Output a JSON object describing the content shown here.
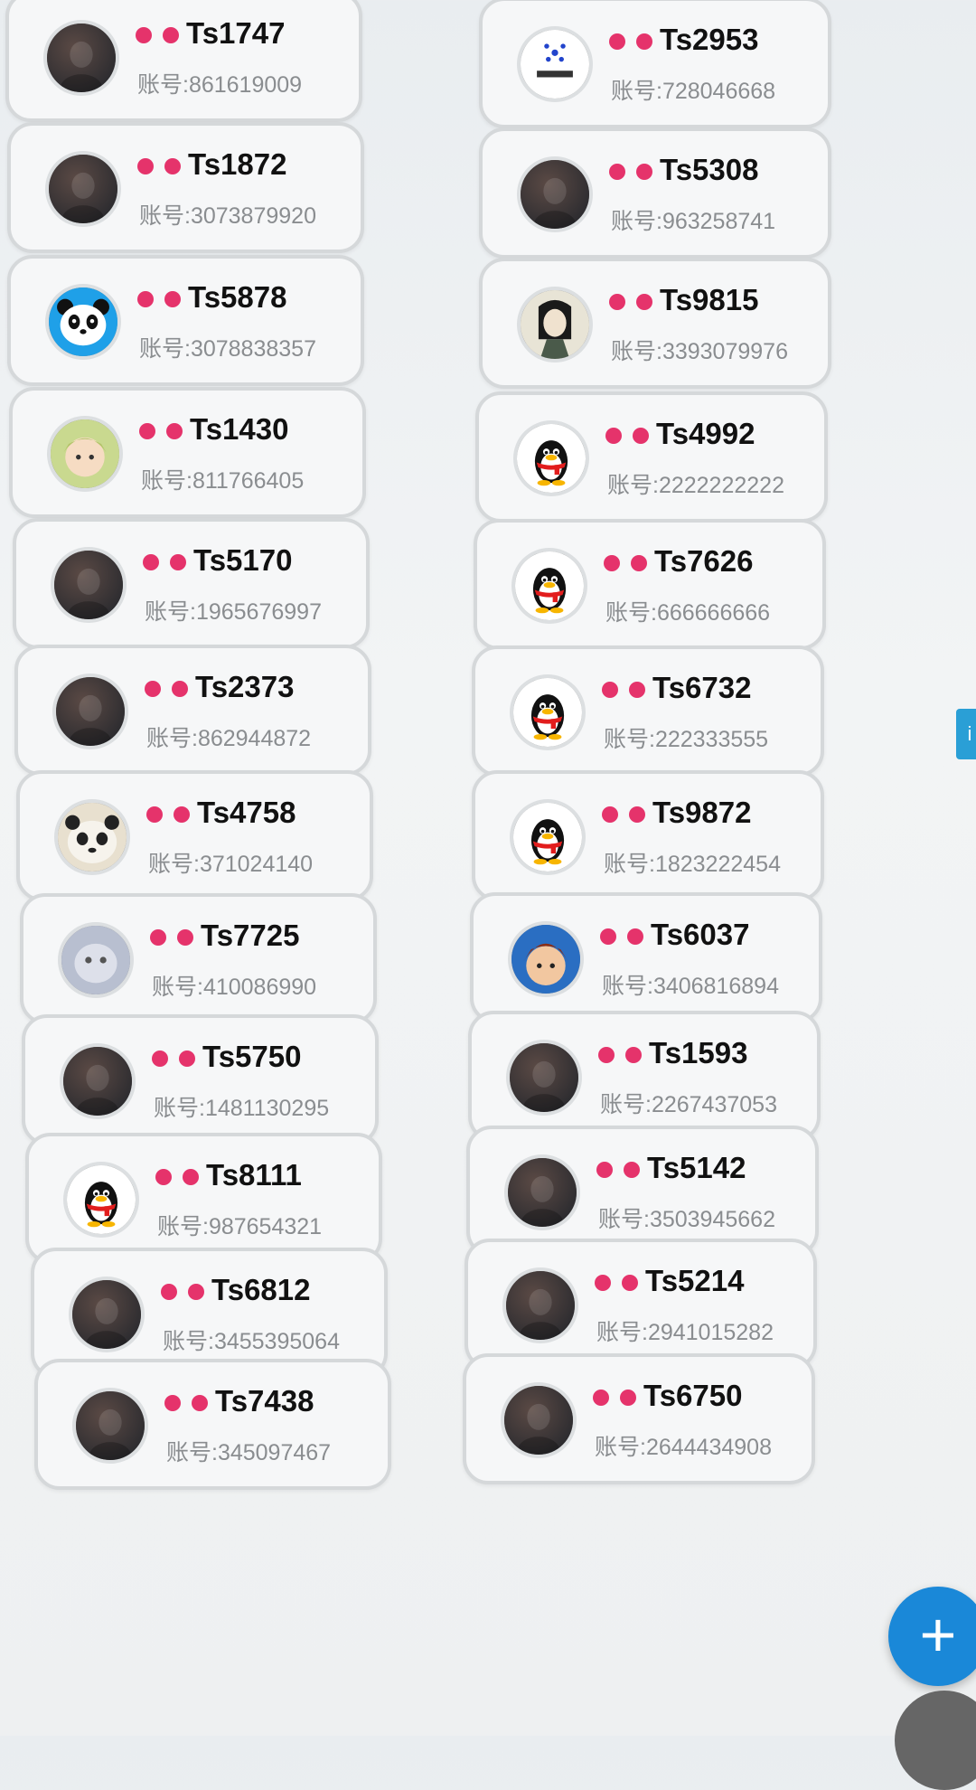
{
  "accounts": {
    "left": [
      {
        "name": "Ts1747",
        "account": "账号:861619009",
        "avatar": "photo-dark"
      },
      {
        "name": "Ts1872",
        "account": "账号:3073879920",
        "avatar": "photo-brown"
      },
      {
        "name": "Ts5878",
        "account": "账号:3078838357",
        "avatar": "panda-cartoon"
      },
      {
        "name": "Ts1430",
        "account": "账号:811766405",
        "avatar": "anime-girl"
      },
      {
        "name": "Ts5170",
        "account": "账号:1965676997",
        "avatar": "photo-dark"
      },
      {
        "name": "Ts2373",
        "account": "账号:862944872",
        "avatar": "photo-brown"
      },
      {
        "name": "Ts4758",
        "account": "账号:371024140",
        "avatar": "panda-photo"
      },
      {
        "name": "Ts7725",
        "account": "账号:410086990",
        "avatar": "cat-photo"
      },
      {
        "name": "Ts5750",
        "account": "账号:1481130295",
        "avatar": "photo-warm"
      },
      {
        "name": "Ts8111",
        "account": "账号:987654321",
        "avatar": "qq-penguin"
      },
      {
        "name": "Ts6812",
        "account": "账号:3455395064",
        "avatar": "photo-dark"
      },
      {
        "name": "Ts7438",
        "account": "账号:345097467",
        "avatar": "photo-red"
      }
    ],
    "right": [
      {
        "name": "Ts2953",
        "account": "账号:728046668",
        "avatar": "logo"
      },
      {
        "name": "Ts5308",
        "account": "账号:963258741",
        "avatar": "photo-gold"
      },
      {
        "name": "Ts9815",
        "account": "账号:3393079976",
        "avatar": "ink-portrait"
      },
      {
        "name": "Ts4992",
        "account": "账号:2222222222",
        "avatar": "qq-penguin"
      },
      {
        "name": "Ts7626",
        "account": "账号:666666666",
        "avatar": "qq-penguin"
      },
      {
        "name": "Ts6732",
        "account": "账号:222333555",
        "avatar": "qq-penguin"
      },
      {
        "name": "Ts9872",
        "account": "账号:1823222454",
        "avatar": "qq-penguin"
      },
      {
        "name": "Ts6037",
        "account": "账号:3406816894",
        "avatar": "anime-boy"
      },
      {
        "name": "Ts1593",
        "account": "账号:2267437053",
        "avatar": "photo-blue"
      },
      {
        "name": "Ts5142",
        "account": "账号:3503945662",
        "avatar": "photo-dark"
      },
      {
        "name": "Ts5214",
        "account": "账号:2941015282",
        "avatar": "photo-light"
      },
      {
        "name": "Ts6750",
        "account": "账号:2644434908",
        "avatar": "photo-warm"
      }
    ]
  },
  "fab": {
    "label": "+",
    "icon": "plus-icon"
  },
  "side_tab": {
    "label": "i"
  },
  "colors": {
    "dot": "#e5336b",
    "fab": "#1a88d8",
    "card_border": "#d5d8da"
  }
}
